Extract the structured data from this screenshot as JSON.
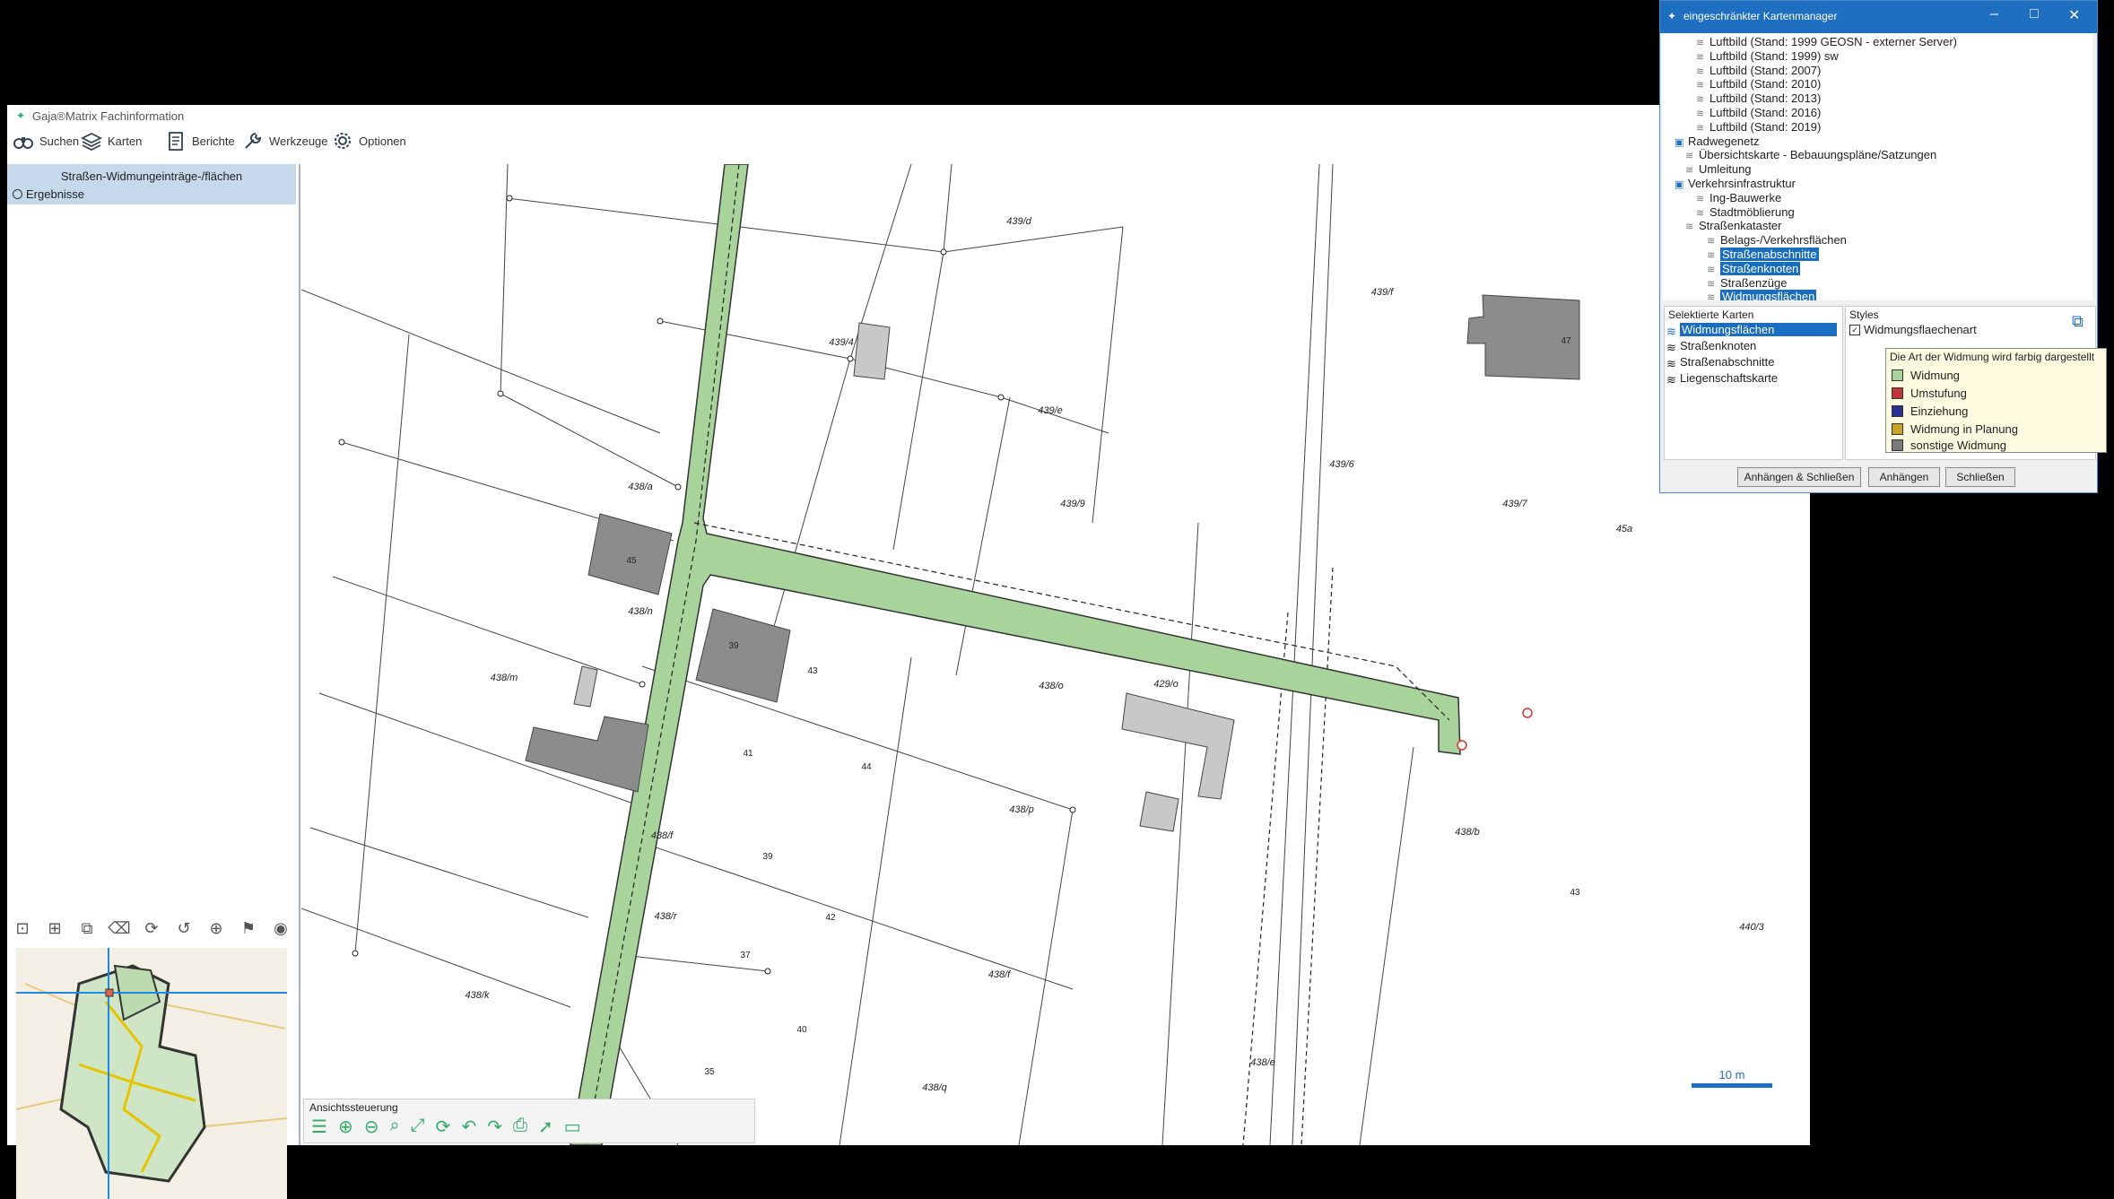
{
  "window": {
    "title": "Gaja®Matrix Fachinformation"
  },
  "toolbar": {
    "search": "Suchen",
    "maps": "Karten",
    "reports": "Berichte",
    "tools": "Werkzeuge",
    "options": "Optionen"
  },
  "panel": {
    "title": "Straßen-Widmungeinträge-/flächen",
    "results": "Ergebnisse"
  },
  "view_control": {
    "label": "Ansichtssteuerung"
  },
  "map": {
    "scale": "10 m",
    "parcels": [
      "439/d",
      "439/f",
      "439/4",
      "439/e",
      "439/6",
      "439/9",
      "439/7",
      "438/a",
      "438/n",
      "438/m",
      "438/o",
      "429/o",
      "438/p",
      "438/b",
      "438/f",
      "438/r",
      "438/f",
      "438/k",
      "438/q",
      "438/e",
      "440/3",
      "45a"
    ],
    "house_numbers": [
      "47",
      "45",
      "39",
      "41",
      "43",
      "44",
      "39",
      "42",
      "37",
      "40",
      "43",
      "35"
    ]
  },
  "dialog": {
    "title": "eingeschränkter Kartenmanager",
    "tree": [
      {
        "label": "Luftbild (Stand: 1999 GEOSN - externer Server)",
        "level": 2
      },
      {
        "label": "Luftbild (Stand: 1999) sw",
        "level": 2
      },
      {
        "label": "Luftbild (Stand: 2007)",
        "level": 2
      },
      {
        "label": "Luftbild (Stand: 2010)",
        "level": 2
      },
      {
        "label": "Luftbild (Stand: 2013)",
        "level": 2
      },
      {
        "label": "Luftbild (Stand: 2016)",
        "level": 2
      },
      {
        "label": "Luftbild (Stand: 2019)",
        "level": 2
      },
      {
        "label": "Radwegenetz",
        "level": 0
      },
      {
        "label": "Übersichtskarte - Bebauungspläne/Satzungen",
        "level": 1
      },
      {
        "label": "Umleitung",
        "level": 1
      },
      {
        "label": "Verkehrsinfrastruktur",
        "level": 0
      },
      {
        "label": "Ing-Bauwerke",
        "level": 2
      },
      {
        "label": "Stadtmöblierung",
        "level": 2
      },
      {
        "label": "Straßenkataster",
        "level": 1
      },
      {
        "label": "Belags-/Verkehrsflächen",
        "level": 3
      },
      {
        "label": "Straßenabschnitte",
        "level": 3,
        "selected": true
      },
      {
        "label": "Straßenknoten",
        "level": 3,
        "selected": true
      },
      {
        "label": "Straßenzüge",
        "level": 3
      },
      {
        "label": "Widmungsflächen",
        "level": 3,
        "selected": true
      }
    ],
    "selected_maps_label": "Selektierte Karten",
    "selected_maps": [
      "Widmungsflächen",
      "Straßenknoten",
      "Straßenabschnitte",
      "Liegenschaftskarte"
    ],
    "styles_label": "Styles",
    "style_item": "Widmungsflaechenart",
    "buttons": {
      "attach_close": "Anhängen & Schließen",
      "attach": "Anhängen",
      "close": "Schließen"
    }
  },
  "tooltip": {
    "title": "Die Art der Widmung wird farbig dargestellt",
    "legend": [
      {
        "label": "Widmung",
        "color": "#a8d39a"
      },
      {
        "label": "Umstufung",
        "color": "#c0353a"
      },
      {
        "label": "Einziehung",
        "color": "#2b2f8f"
      },
      {
        "label": "Widmung in Planung",
        "color": "#c9a227"
      },
      {
        "label": "sonstige Widmung",
        "color": "#7a7a7a"
      }
    ]
  }
}
